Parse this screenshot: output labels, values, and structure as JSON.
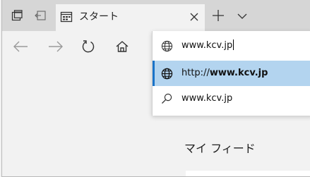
{
  "window": {
    "tab_actions_icon": "tab-actions-icon",
    "set_aside_icon": "set-aside-tabs-icon"
  },
  "tab": {
    "title": "スタート",
    "favicon": "start-page-icon",
    "close_icon": "close-icon"
  },
  "tabbar": {
    "new_tab_icon": "plus-icon",
    "tab_preview_icon": "chevron-down-icon"
  },
  "nav": {
    "back_icon": "arrow-left-icon",
    "forward_icon": "arrow-right-icon",
    "refresh_icon": "refresh-icon",
    "home_icon": "home-icon"
  },
  "address_bar": {
    "value": "www.kcv.jp",
    "icon": "globe-icon"
  },
  "suggestions": [
    {
      "icon": "globe-icon",
      "prefix": "http://",
      "bold": "www.kcv.jp",
      "selected": true
    },
    {
      "icon": "search-icon",
      "text": "www.kcv.jp",
      "selected": false
    }
  ],
  "page": {
    "feed_title": "マイ フィード"
  },
  "colors": {
    "tabbar_bg": "#d6d6d6",
    "chrome_bg": "#f2f2f2",
    "selected_bg": "#b3d4ef",
    "accent": "#1a73c8"
  }
}
